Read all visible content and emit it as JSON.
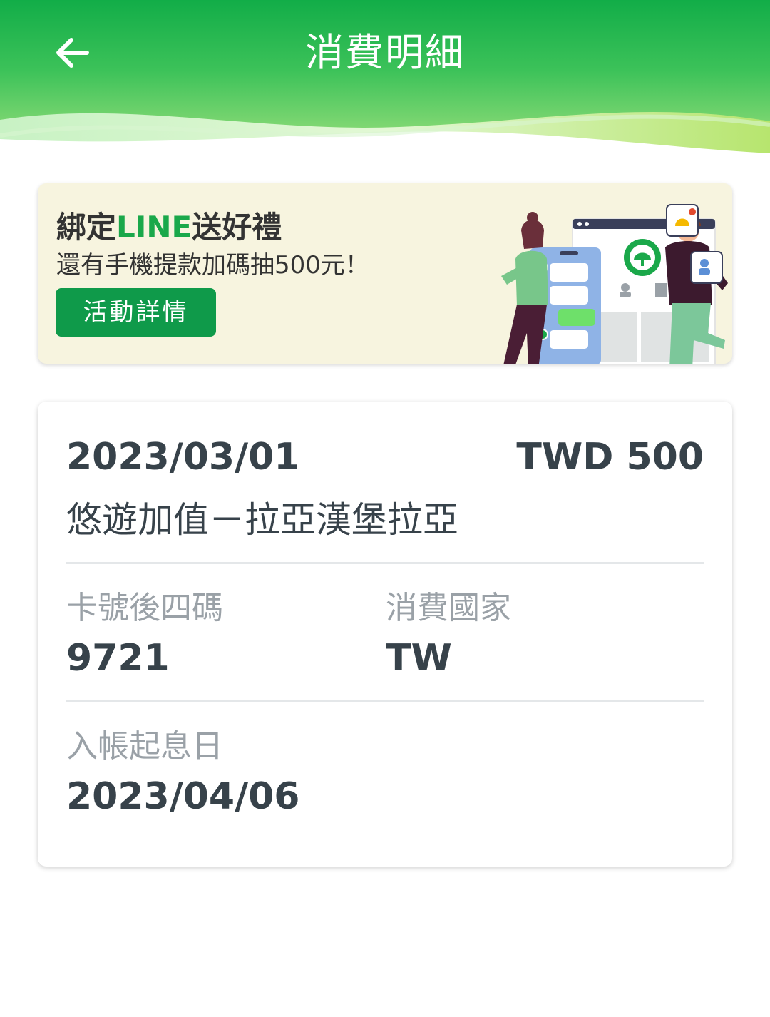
{
  "header": {
    "title": "消費明細"
  },
  "promo": {
    "title_prefix": "綁定",
    "title_accent": "LINE",
    "title_suffix": "送好禮",
    "subtitle": "還有手機提款加碼抽500元！",
    "button_label": "活動詳情"
  },
  "transaction": {
    "date": "2023/03/01",
    "amount": "TWD 500",
    "merchant": "悠遊加值－拉亞漢堡拉亞",
    "card_last4_label": "卡號後四碼",
    "card_last4": "9721",
    "country_label": "消費國家",
    "country": "TW",
    "posting_date_label": "入帳起息日",
    "posting_date": "2023/04/06"
  }
}
